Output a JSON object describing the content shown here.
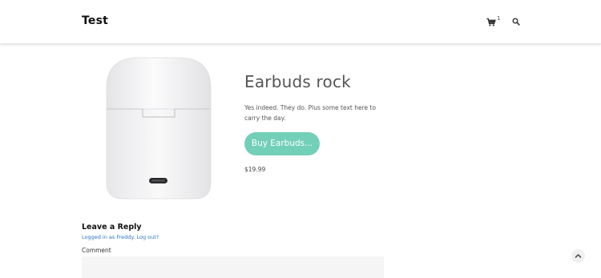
{
  "header": {
    "site_title": "Test",
    "cart_count": "1",
    "cart_icon": "shopping-cart-icon",
    "search_icon": "search-icon"
  },
  "product": {
    "title": "Earbuds rock",
    "description": "Yes indeed. They do. Plus some text here to carry the day.",
    "buy_button_label": "Buy Earbuds...",
    "price": "$19.99",
    "image": "earbuds-case-image"
  },
  "comments": {
    "heading": "Leave a Reply",
    "logged_in_prefix": "Logged in as Freddy.",
    "logout_label": "Log out?",
    "comment_label": "Comment",
    "comment_value": ""
  },
  "back_to_top_icon": "chevron-up-icon",
  "colors": {
    "accent": "#72cfb8",
    "link": "#2a73c8"
  }
}
